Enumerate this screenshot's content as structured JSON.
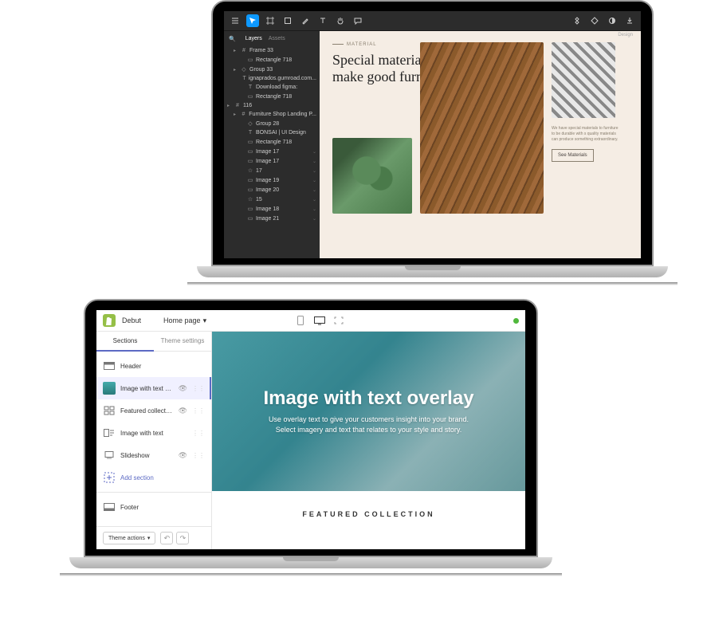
{
  "figma": {
    "toolbar_icons": [
      "menu",
      "move",
      "frame",
      "pen",
      "text",
      "hand",
      "comment",
      "component",
      "mask",
      "boolean",
      "zoom"
    ],
    "left_header_search": "Layers",
    "tabs": {
      "layers": "Layers",
      "assets": "Assets"
    },
    "right_tab": "Design",
    "layers": [
      {
        "depth": 1,
        "icon": "#",
        "label": "Frame 33",
        "chev": true
      },
      {
        "depth": 2,
        "icon": "▭",
        "label": "Rectangle 718"
      },
      {
        "depth": 1,
        "icon": "◇",
        "label": "Group 33",
        "chev": true
      },
      {
        "depth": 2,
        "icon": "T",
        "label": "ignaprados.gumroad.com..."
      },
      {
        "depth": 2,
        "icon": "T",
        "label": "Download figma:"
      },
      {
        "depth": 2,
        "icon": "▭",
        "label": "Rectangle 718"
      },
      {
        "depth": 0,
        "icon": "#",
        "label": "116",
        "chev": true
      },
      {
        "depth": 1,
        "icon": "#",
        "label": "Furniture Shop Landing P...",
        "chev": true
      },
      {
        "depth": 2,
        "icon": "◇",
        "label": "Group 28"
      },
      {
        "depth": 2,
        "icon": "T",
        "label": "BONSAI | UI Design"
      },
      {
        "depth": 2,
        "icon": "▭",
        "label": "Rectangle 718"
      },
      {
        "depth": 2,
        "icon": "▭",
        "label": "Image 17",
        "eye": true
      },
      {
        "depth": 2,
        "icon": "▭",
        "label": "Image 17",
        "eye": true
      },
      {
        "depth": 2,
        "icon": "☆",
        "label": "17",
        "eye": true
      },
      {
        "depth": 2,
        "icon": "▭",
        "label": "Image 19",
        "eye": true
      },
      {
        "depth": 2,
        "icon": "▭",
        "label": "Image 20",
        "eye": true
      },
      {
        "depth": 2,
        "icon": "☆",
        "label": "15",
        "eye": true
      },
      {
        "depth": 2,
        "icon": "▭",
        "label": "Image 18",
        "eye": true
      },
      {
        "depth": 2,
        "icon": "▭",
        "label": "Image 21",
        "eye": true
      }
    ],
    "canvas": {
      "section_label": "MATERIAL",
      "heading": "Special materials to make good furniture",
      "side_text": "We have special materials to furniture to be durable with s quality materials can produce something extraordinary.",
      "button": "See Materials"
    }
  },
  "shopify": {
    "theme_name": "Debut",
    "page_selector": "Home page",
    "sidebar_tabs": {
      "sections": "Sections",
      "theme_settings": "Theme settings"
    },
    "sections": [
      {
        "icon": "header",
        "label": "Header"
      },
      {
        "icon": "thumb",
        "label": "Image with text ov...",
        "eye": true,
        "selected": true,
        "drag": true
      },
      {
        "icon": "collection",
        "label": "Featured collection",
        "eye": true,
        "drag": true
      },
      {
        "icon": "imgtext",
        "label": "Image with text",
        "drag": true
      },
      {
        "icon": "slideshow",
        "label": "Slideshow",
        "eye": true,
        "drag": true
      },
      {
        "icon": "add",
        "label": "Add section",
        "add": true
      },
      {
        "divider": true
      },
      {
        "icon": "footer",
        "label": "Footer"
      }
    ],
    "theme_actions": "Theme actions",
    "preview": {
      "hero_title": "Image with text overlay",
      "hero_text": "Use overlay text to give your customers insight into your brand. Select imagery and text that relates to your style and story.",
      "featured_title": "FEATURED COLLECTION"
    }
  }
}
